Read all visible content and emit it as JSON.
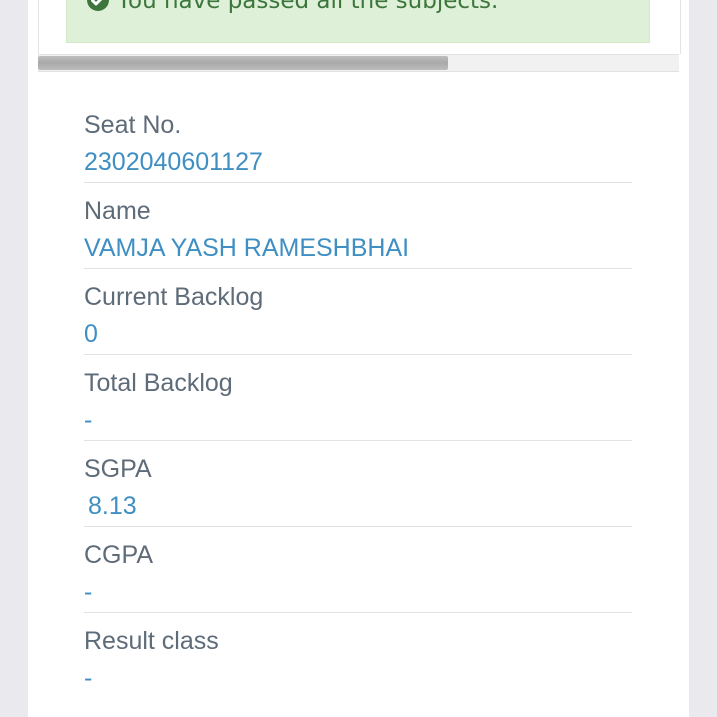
{
  "alert": {
    "icon": "check-circle-icon",
    "text": "You have passed all the subjects.",
    "color": "#3c763d",
    "background": "#dff0d8"
  },
  "scrollbar": {
    "thumb_fraction": 0.64
  },
  "result": {
    "seat_no_label": "Seat No.",
    "seat_no_value": "2302040601127",
    "name_label": "Name",
    "name_value": "VAMJA YASH RAMESHBHAI",
    "current_backlog_label": "Current Backlog",
    "current_backlog_value": "0",
    "total_backlog_label": "Total Backlog",
    "total_backlog_value": "-",
    "sgpa_label": "SGPA",
    "sgpa_value": "8.13",
    "cgpa_label": "CGPA",
    "cgpa_value": "-",
    "result_class_label": "Result class",
    "result_class_value": "-"
  },
  "colors": {
    "label": "#5e6b78",
    "value": "#3f8fc2"
  }
}
